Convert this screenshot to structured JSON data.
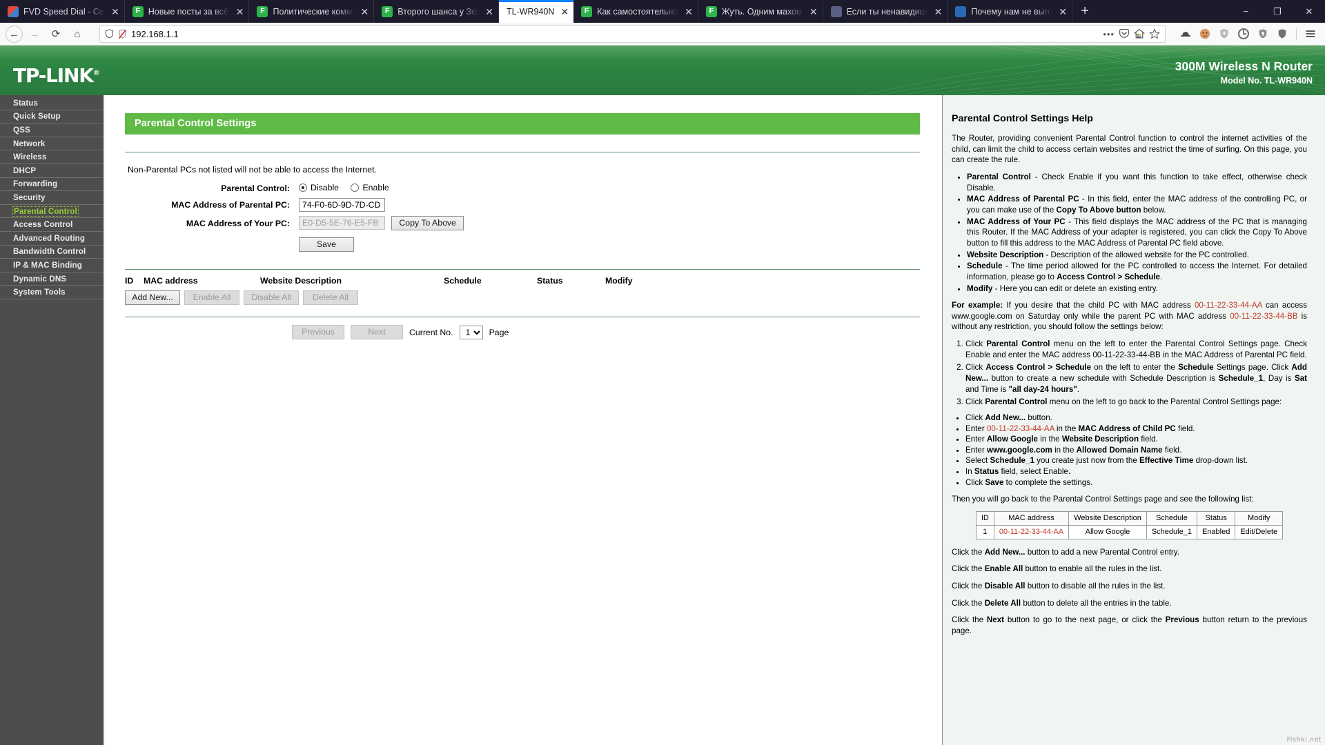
{
  "browser": {
    "tabs": [
      {
        "title": "FVD Speed Dial - Сервис",
        "favicon": "fvd-icon",
        "active": false
      },
      {
        "title": "Новые посты за всё вре",
        "favicon": "f-icon",
        "active": false
      },
      {
        "title": "Политические коммен",
        "favicon": "f-icon",
        "active": false
      },
      {
        "title": "Второго шанса у Зелен",
        "favicon": "f-icon",
        "active": false
      },
      {
        "title": "TL-WR940N",
        "favicon": "none",
        "active": true
      },
      {
        "title": "Как самостоятельно на",
        "favicon": "f-icon",
        "active": false
      },
      {
        "title": "Жуть. Одним махом – с",
        "favicon": "f-icon",
        "active": false
      },
      {
        "title": "Если ты ненавидишь —",
        "favicon": "user-icon",
        "active": false
      },
      {
        "title": "Почему нам не выгоде",
        "favicon": "globe-icon",
        "active": false
      }
    ],
    "close_label": "✕",
    "new_tab_label": "+",
    "window_controls": {
      "minimize": "−",
      "maximize": "❐",
      "close": "✕"
    },
    "nav": {
      "back": "←",
      "forward": "→",
      "reload": "⟳",
      "home": "⌂"
    },
    "url": "192.168.1.1",
    "url_overflow": "•••",
    "toolbar_icons": [
      "pocket-icon",
      "home-colored-icon",
      "bookmark-star-icon",
      "hat-icon",
      "avatar-icon",
      "shield-grey-icon",
      "adblock-icon",
      "shield-small-icon",
      "ublock-icon",
      "menu-icon"
    ]
  },
  "router": {
    "logo": "TP-LINK",
    "logo_reg": "®",
    "model_line1": "300M Wireless N Router",
    "model_line2": "Model No. TL-WR940N",
    "menu": [
      {
        "label": "Status",
        "active": false
      },
      {
        "label": "Quick Setup",
        "active": false
      },
      {
        "label": "QSS",
        "active": false
      },
      {
        "label": "Network",
        "active": false
      },
      {
        "label": "Wireless",
        "active": false
      },
      {
        "label": "DHCP",
        "active": false
      },
      {
        "label": "Forwarding",
        "active": false
      },
      {
        "label": "Security",
        "active": false
      },
      {
        "label": "Parental Control",
        "active": true
      },
      {
        "label": "Access Control",
        "active": false
      },
      {
        "label": "Advanced Routing",
        "active": false
      },
      {
        "label": "Bandwidth Control",
        "active": false
      },
      {
        "label": "IP & MAC Binding",
        "active": false
      },
      {
        "label": "Dynamic DNS",
        "active": false
      },
      {
        "label": "System Tools",
        "active": false
      }
    ],
    "panel_title": "Parental Control Settings",
    "note": "Non-Parental PCs not listed will not be able to access the Internet.",
    "form": {
      "parental_control_label": "Parental Control:",
      "disable_label": "Disable",
      "enable_label": "Enable",
      "selected": "Disable",
      "mac_parental_label": "MAC Address of Parental PC:",
      "mac_parental_value": "74-F0-6D-9D-7D-CD",
      "mac_your_label": "MAC Address of Your PC:",
      "mac_your_value": "E0-D5-5E-76-E5-FB",
      "copy_to_above_label": "Copy To Above",
      "save_label": "Save"
    },
    "list_headers": {
      "id": "ID",
      "mac": "MAC address",
      "description": "Website Description",
      "schedule": "Schedule",
      "status": "Status",
      "modify": "Modify"
    },
    "list_rows": [],
    "list_buttons": {
      "add_new": "Add New...",
      "enable_all": "Enable All",
      "disable_all": "Disable All",
      "delete_all": "Delete All"
    },
    "pagination": {
      "previous": "Previous",
      "next": "Next",
      "current_label": "Current No.",
      "current_value": "1",
      "page_label": "Page"
    },
    "accent_green": "#5fbb46",
    "header_green": "#2b8040",
    "active_menu_color": "#9acd32"
  },
  "help": {
    "title": "Parental Control Settings Help",
    "intro": "The Router, providing convenient Parental Control function to control the internet activities of the child, can limit the child to access certain websites and restrict the time of surfing. On this page, you can create the rule.",
    "bullets": [
      {
        "term": "Parental Control",
        "text": " - Check Enable if you want this function to take effect, otherwise check Disable."
      },
      {
        "term": "MAC Address of Parental PC",
        "text": " - In this field, enter the MAC address of the controlling PC, or you can make use of the ",
        "bold_tail": "Copy To Above button",
        "tail": " below."
      },
      {
        "term": "MAC Address of Your PC",
        "text": " - This field displays the MAC address of the PC that is managing this Router. If the MAC Address of your adapter is registered, you can click the Copy To Above button to fill this address to the MAC Address of Parental PC field above."
      },
      {
        "term": "Website Description",
        "text": " - Description of the allowed website for the PC controlled."
      },
      {
        "term": "Schedule",
        "text": " - The time period allowed for the PC controlled to access the Internet. For detailed information, please go to ",
        "bold_tail": "Access Control > Schedule",
        "tail": "."
      },
      {
        "term": "Modify",
        "text": " - Here you can edit or delete an existing entry."
      }
    ],
    "example_label": "For example:",
    "example_text_1": " If you desire that the child PC with MAC address ",
    "example_mac_1": "00-11-22-33-44-AA",
    "example_text_2": " can access www.google.com on Saturday only while the parent PC with MAC address ",
    "example_mac_2": "00-11-22-33-44-BB",
    "example_text_3": " is without any restriction, you should follow the settings below:",
    "steps": [
      {
        "parts": [
          {
            "t": "Click ",
            "b": false
          },
          {
            "t": "Parental Control",
            "b": true
          },
          {
            "t": " menu on the left to enter the Parental Control Settings page. Check Enable and enter the MAC address 00-11-22-33-44-BB in the MAC Address of Parental PC field.",
            "b": false
          }
        ]
      },
      {
        "parts": [
          {
            "t": "Click ",
            "b": false
          },
          {
            "t": "Access Control > Schedule",
            "b": true
          },
          {
            "t": " on the left to enter the ",
            "b": false
          },
          {
            "t": "Schedule",
            "b": true
          },
          {
            "t": " Settings page. Click ",
            "b": false
          },
          {
            "t": "Add New...",
            "b": true
          },
          {
            "t": " button to create a new schedule with Schedule Description is ",
            "b": false
          },
          {
            "t": "Schedule_1",
            "b": true
          },
          {
            "t": ", Day is ",
            "b": false
          },
          {
            "t": "Sat",
            "b": true
          },
          {
            "t": " and Time is ",
            "b": false
          },
          {
            "t": "\"all day-24 hours\"",
            "b": true
          },
          {
            "t": ".",
            "b": false
          }
        ]
      },
      {
        "parts": [
          {
            "t": "Click ",
            "b": false
          },
          {
            "t": "Parental Control",
            "b": true
          },
          {
            "t": " menu on the left to go back to the Parental Control Settings page:",
            "b": false
          }
        ]
      }
    ],
    "substeps": [
      {
        "parts": [
          {
            "t": "Click ",
            "b": false
          },
          {
            "t": "Add New...",
            "b": true
          },
          {
            "t": " button.",
            "b": false
          }
        ]
      },
      {
        "parts": [
          {
            "t": "Enter ",
            "b": false
          },
          {
            "t": "00-11-22-33-44-AA",
            "b": false,
            "red": true
          },
          {
            "t": " in the ",
            "b": false
          },
          {
            "t": "MAC Address of Child PC",
            "b": true
          },
          {
            "t": " field.",
            "b": false
          }
        ]
      },
      {
        "parts": [
          {
            "t": "Enter ",
            "b": false
          },
          {
            "t": "Allow Google",
            "b": true
          },
          {
            "t": " in the ",
            "b": false
          },
          {
            "t": "Website Description",
            "b": true
          },
          {
            "t": " field.",
            "b": false
          }
        ]
      },
      {
        "parts": [
          {
            "t": "Enter ",
            "b": false
          },
          {
            "t": "www.google.com",
            "b": true
          },
          {
            "t": " in the ",
            "b": false
          },
          {
            "t": "Allowed Domain Name",
            "b": true
          },
          {
            "t": " field.",
            "b": false
          }
        ]
      },
      {
        "parts": [
          {
            "t": "Select ",
            "b": false
          },
          {
            "t": "Schedule_1",
            "b": true
          },
          {
            "t": " you create just now from the ",
            "b": false
          },
          {
            "t": "Effective Time",
            "b": true
          },
          {
            "t": " drop-down list.",
            "b": false
          }
        ]
      },
      {
        "parts": [
          {
            "t": "In ",
            "b": false
          },
          {
            "t": "Status",
            "b": true
          },
          {
            "t": " field, select Enable.",
            "b": false
          }
        ]
      },
      {
        "parts": [
          {
            "t": "Click ",
            "b": false
          },
          {
            "t": "Save",
            "b": true
          },
          {
            "t": " to complete the settings.",
            "b": false
          }
        ]
      }
    ],
    "then_text": "Then you will go back to the Parental Control Settings page and see the following list:",
    "example_table": {
      "headers": [
        "ID",
        "MAC address",
        "Website Description",
        "Schedule",
        "Status",
        "Modify"
      ],
      "row": [
        "1",
        "00-11-22-33-44-AA",
        "Allow Google",
        "Schedule_1",
        "Enabled",
        "Edit/Delete"
      ]
    },
    "footers": [
      {
        "parts": [
          {
            "t": "Click the ",
            "b": false
          },
          {
            "t": "Add New...",
            "b": true
          },
          {
            "t": " button to add a new Parental Control entry.",
            "b": false
          }
        ]
      },
      {
        "parts": [
          {
            "t": "Click the ",
            "b": false
          },
          {
            "t": "Enable All",
            "b": true
          },
          {
            "t": " button to enable all the rules in the list.",
            "b": false
          }
        ]
      },
      {
        "parts": [
          {
            "t": "Click the ",
            "b": false
          },
          {
            "t": "Disable All",
            "b": true
          },
          {
            "t": " button to disable all the rules in the list.",
            "b": false
          }
        ]
      },
      {
        "parts": [
          {
            "t": "Click the ",
            "b": false
          },
          {
            "t": "Delete All",
            "b": true
          },
          {
            "t": " button to delete all the entries in the table.",
            "b": false
          }
        ]
      },
      {
        "parts": [
          {
            "t": "Click the ",
            "b": false
          },
          {
            "t": "Next",
            "b": true
          },
          {
            "t": " button to go to the next page, or click the ",
            "b": false
          },
          {
            "t": "Previous",
            "b": true
          },
          {
            "t": " button return to the previous page.",
            "b": false
          }
        ]
      }
    ]
  },
  "watermark": "Fishki.net"
}
